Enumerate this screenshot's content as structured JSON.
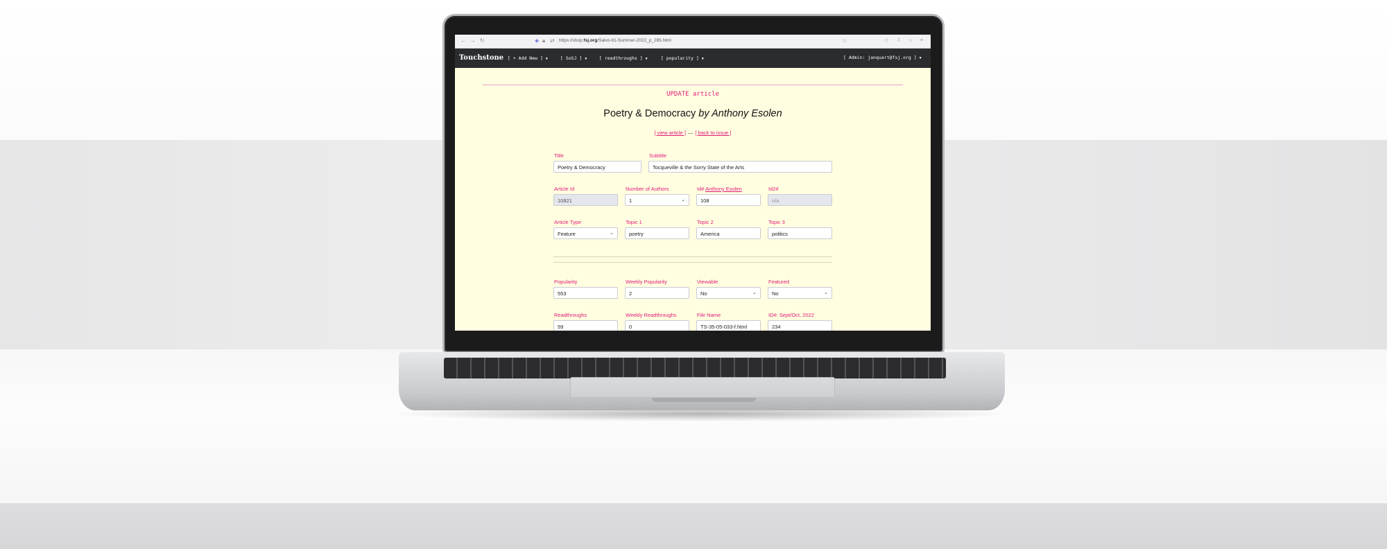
{
  "browser": {
    "url_prefix": "https://shop.",
    "url_domain": "fsj.org",
    "url_path": "/Salvo-61-Summer-2022_p_285.html"
  },
  "nav": {
    "brand": "Touchstone",
    "add_new": "[ + Add New ]",
    "sosj": "[ SoSJ ]",
    "readthroughs": "[ readthroughs ]",
    "popularity": "[ popularity ]",
    "admin": "[ Admin: janquart@fsj.org ]"
  },
  "page": {
    "heading": "UPDATE article",
    "article_title": "Poetry & Democracy",
    "byline": "by Anthony Esolen",
    "view_article": "[ view article ]",
    "separator": "—",
    "back_to_issue": "[ back to issue ]"
  },
  "form": {
    "title": {
      "label": "Title",
      "value": "Poetry & Democracy"
    },
    "subtitle": {
      "label": "Subtitle",
      "value": "Tocqueville & the Sorry State of the Arts"
    },
    "article_id": {
      "label": "Article Id",
      "value": "10821"
    },
    "num_authors": {
      "label": "Number of Authors",
      "value": "1"
    },
    "id1": {
      "label_prefix": "Id# ",
      "label_link": "Anthony Esolen",
      "value": "108"
    },
    "id2": {
      "label": "Id2#",
      "value": "n/a"
    },
    "article_type": {
      "label": "Article Type",
      "value": "Feature"
    },
    "topic1": {
      "label": "Topic 1",
      "value": "poetry"
    },
    "topic2": {
      "label": "Topic 2",
      "value": "America"
    },
    "topic3": {
      "label": "Topic 3",
      "value": "politics"
    },
    "popularity": {
      "label": "Popularity",
      "value": "553"
    },
    "weekly_popularity": {
      "label": "Weekly Popularity",
      "value": "2"
    },
    "viewable": {
      "label": "Viewable",
      "value": "No"
    },
    "featured": {
      "label": "Featured",
      "value": "No"
    },
    "readthroughs": {
      "label": "Readthroughs",
      "value": "59"
    },
    "weekly_readthroughs": {
      "label": "Weekly Readthroughs",
      "value": "0"
    },
    "file_name": {
      "label": "File Name",
      "value": "TS-35-05-033-f.html"
    },
    "issue_id": {
      "label": "ID#: Sept/Oct, 2022",
      "value": "234"
    }
  },
  "icons": {
    "back": "←",
    "forward": "→",
    "reload": "↻",
    "star": "☆",
    "chevron": "⌄"
  }
}
